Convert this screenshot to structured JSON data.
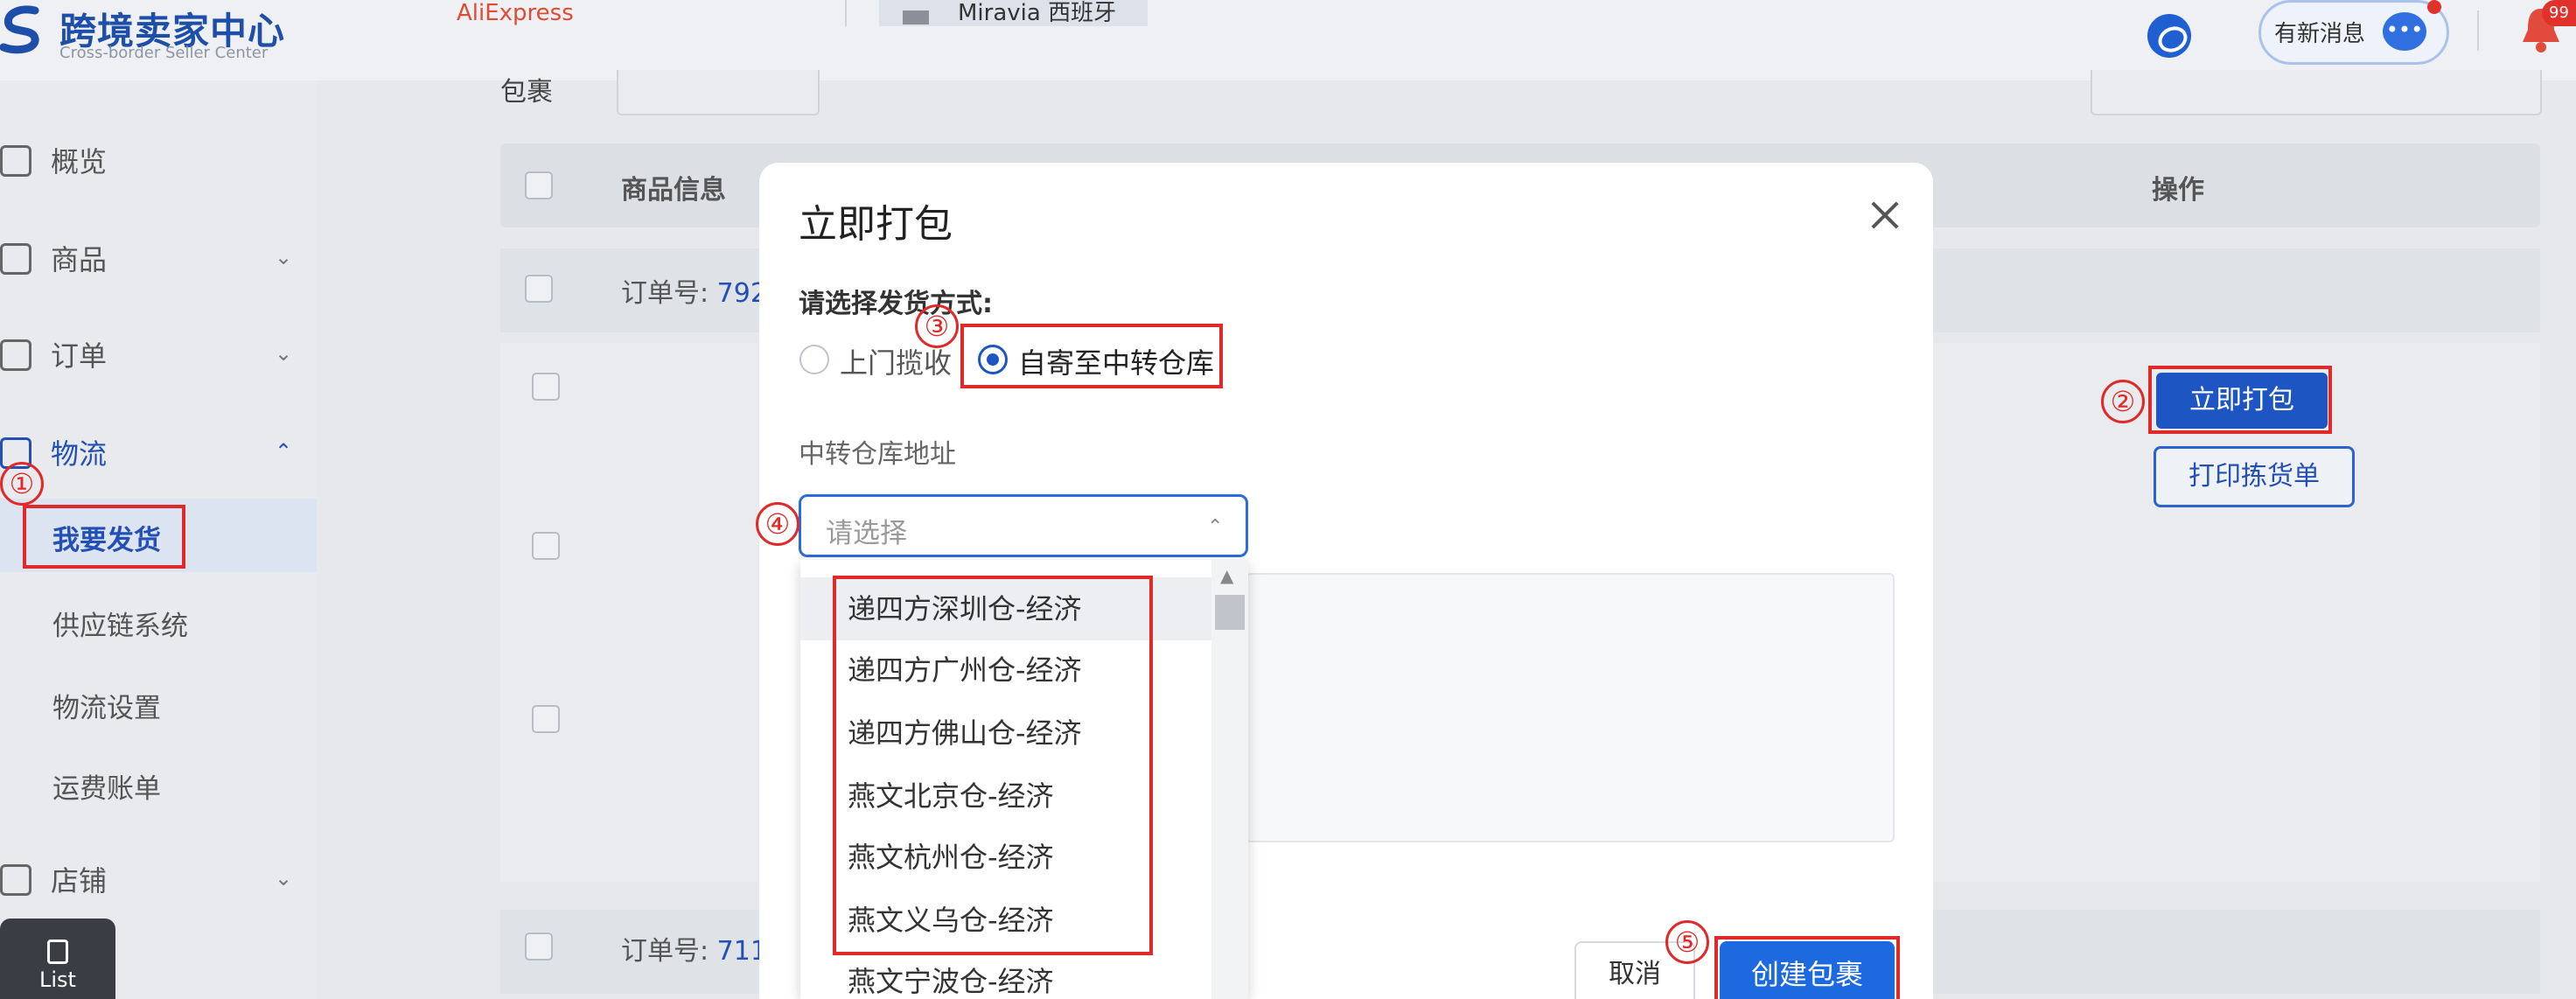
{
  "header": {
    "logo_title": "跨境卖家中心",
    "logo_subtitle": "Cross-border Seller Center",
    "site_aliexpress": "AliExpress",
    "site_miravia": "Miravia 西班牙",
    "messages_label": "有新消息",
    "bell_badge": "99",
    "brand_color": "#1e4fa8"
  },
  "sidebar": {
    "items": [
      {
        "label": "概览",
        "icon": "home-icon"
      },
      {
        "label": "商品",
        "icon": "product-icon"
      },
      {
        "label": "订单",
        "icon": "order-icon"
      },
      {
        "label": "物流",
        "icon": "logistics-icon"
      },
      {
        "label": "店铺",
        "icon": "store-icon"
      }
    ],
    "logistics_sub": [
      {
        "label": "我要发货",
        "selected": true
      },
      {
        "label": "供应链系统"
      },
      {
        "label": "物流设置"
      },
      {
        "label": "运费账单"
      }
    ],
    "list_button": "List"
  },
  "table": {
    "filter_label": "包裹",
    "col_info": "商品信息",
    "col_op": "操作",
    "order_prefix": "订单号:",
    "order1_num": "792",
    "order2_num": "711",
    "pack_now_button": "立即打包",
    "print_pick_button": "打印拣货单"
  },
  "modal": {
    "title": "立即打包",
    "method_label": "请选择发货方式:",
    "option_pickup": "上门揽收",
    "option_selfsend": "自寄至中转仓库",
    "selected_option": "自寄至中转仓库",
    "warehouse_label": "中转仓库地址",
    "select_placeholder": "请选择",
    "warehouses": [
      "递四方深圳仓-经济",
      "递四方广州仓-经济",
      "递四方佛山仓-经济",
      "燕文北京仓-经济",
      "燕文杭州仓-经济",
      "燕文义乌仓-经济",
      "燕文宁波仓-经济"
    ],
    "cancel_button": "取消",
    "create_button": "创建包裹",
    "accent_color": "#1d6ae0"
  },
  "annotations": {
    "step1": "①",
    "step2": "②",
    "step3": "③",
    "step4": "④",
    "step5": "⑤",
    "color": "#e02a2a"
  }
}
